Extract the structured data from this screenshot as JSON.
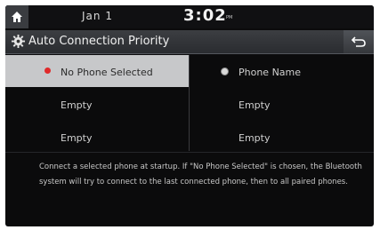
{
  "status": {
    "date": "Jan 1",
    "time": "3:02",
    "ampm": "PM"
  },
  "header": {
    "title": "Auto Connection Priority"
  },
  "list": {
    "left": [
      {
        "label": "No Phone Selected",
        "selected": true
      },
      {
        "label": "Empty"
      },
      {
        "label": "Empty"
      }
    ],
    "right": [
      {
        "label": "Phone Name"
      },
      {
        "label": "Empty"
      },
      {
        "label": "Empty"
      }
    ]
  },
  "description": "Connect a selected phone at startup. If \"No Phone Selected\" is chosen, the Bluetooth system will try to connect to the last connected phone, then to all paired phones.",
  "colors": {
    "accent": "#e02a2a",
    "selected_bg": "#c7c8ca",
    "background": "#0b0b0c"
  },
  "icons": {
    "home": "home-icon",
    "settings": "gear-icon",
    "back": "back-icon"
  }
}
